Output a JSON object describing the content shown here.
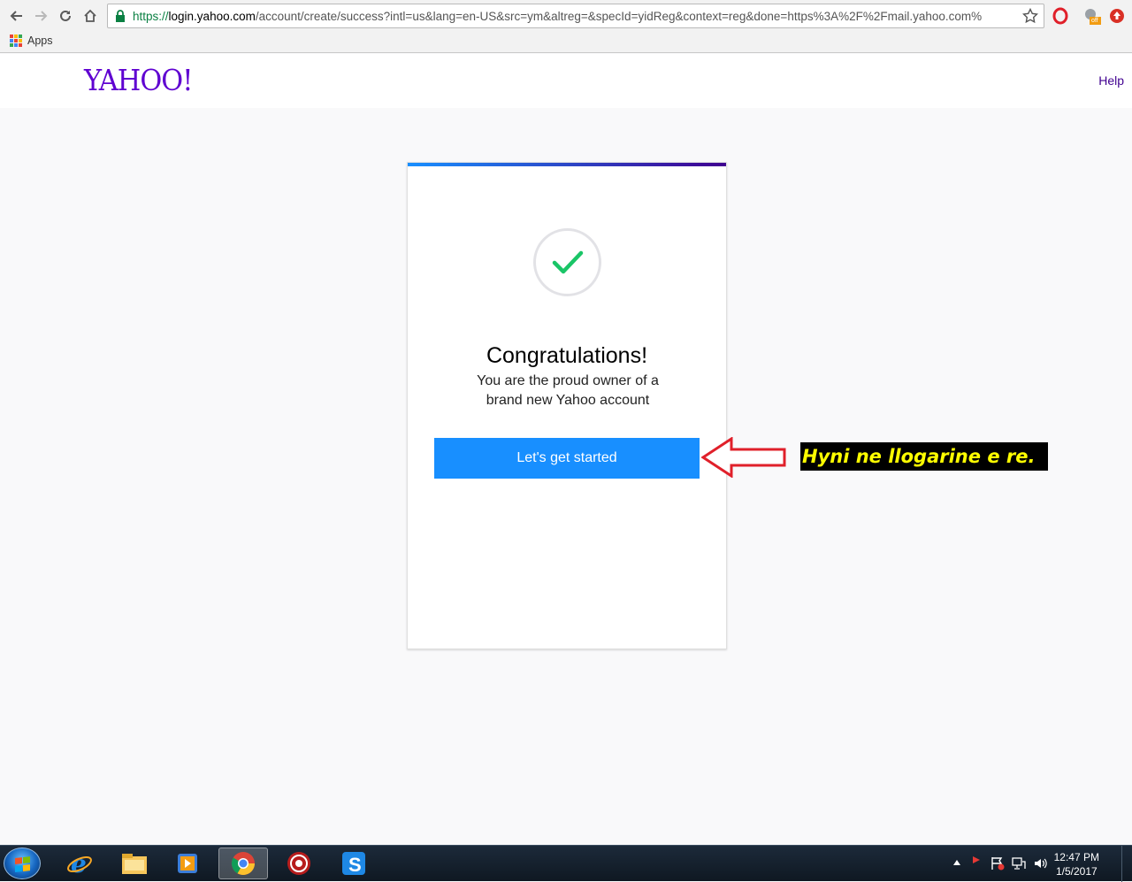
{
  "browser": {
    "url_scheme": "https://",
    "url_host": "login.yahoo.com",
    "url_rest": "/account/create/success?intl=us&lang=en-US&src=ym&altreg=&specId=yidReg&context=reg&done=https%3A%2F%2Fmail.yahoo.com%",
    "bookmarks_apps_label": "Apps",
    "extension_badge": "off"
  },
  "header": {
    "logo_text": "YAHOO!",
    "help_label": "Help"
  },
  "card": {
    "title": "Congratulations!",
    "subtitle": "You are the proud owner of a brand new Yahoo account",
    "cta_label": "Let's get started"
  },
  "annotation": {
    "text": "Hyni ne llogarine e re."
  },
  "taskbar": {
    "time": "12:47 PM",
    "date": "1/5/2017"
  },
  "colors": {
    "yahoo_purple": "#5f01d1",
    "cta_blue": "#188fff",
    "check_green": "#1ac567",
    "arrow_red": "#e0202a"
  }
}
